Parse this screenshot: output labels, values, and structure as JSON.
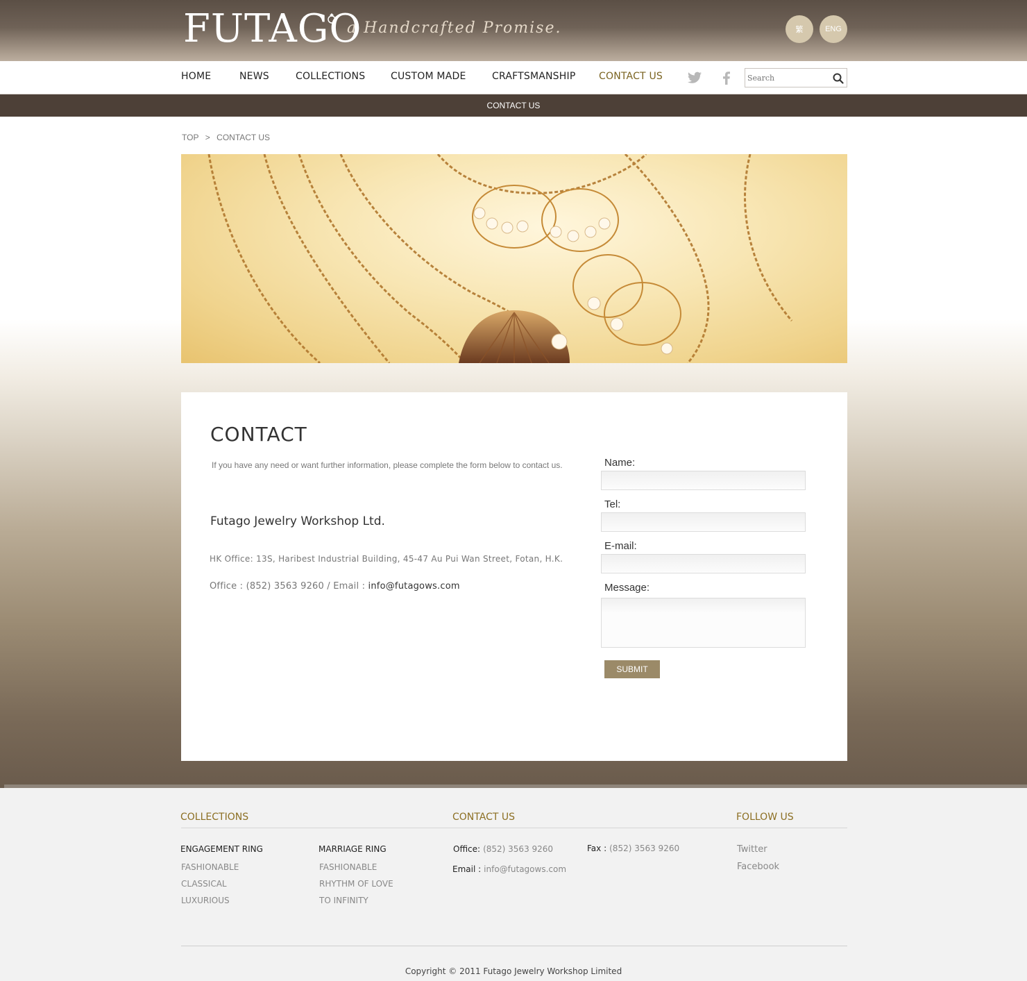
{
  "header": {
    "logo_text": "FUTAGO",
    "tagline": "a Handcrafted Promise.",
    "lang_zh": "繁",
    "lang_en": "ENG"
  },
  "nav": {
    "items": [
      "HOME",
      "NEWS",
      "COLLECTIONS",
      "CUSTOM MADE",
      "CRAFTSMANSHIP",
      "CONTACT US"
    ],
    "active": "CONTACT US",
    "search_placeholder": "Search"
  },
  "subbar": {
    "title": "CONTACT US"
  },
  "breadcrumb": {
    "top": "TOP",
    "sep": ">",
    "current": "CONTACT US"
  },
  "contact": {
    "title": "CONTACT",
    "intro": "If you have any need or want further information, please complete the form below to contact us.",
    "company": "Futago Jewelry Workshop Ltd.",
    "address": "HK Office: 13S, Haribest Industrial Building, 45-47 Au Pui Wan Street, Fotan, H.K.",
    "office_prefix": "Office : (852) 3563 9260 / Email : ",
    "email": "info@futagows.com"
  },
  "form": {
    "name_label": "Name:",
    "tel_label": "Tel:",
    "email_label": "E-mail:",
    "message_label": "Message:",
    "submit_label": "SUBMIT"
  },
  "footer": {
    "collections_heading": "COLLECTIONS",
    "engagement": {
      "heading": "ENGAGEMENT RING",
      "items": [
        "FASHIONABLE",
        "CLASSICAL",
        "LUXURIOUS"
      ]
    },
    "marriage": {
      "heading": "MARRIAGE RING",
      "items": [
        "FASHIONABLE",
        "RHYTHM OF LOVE",
        "TO INFINITY"
      ]
    },
    "contact_heading": "CONTACT US",
    "office_label": "Office:",
    "office_value": "(852) 3563 9260",
    "fax_label": "Fax :",
    "fax_value": "(852) 3563 9260",
    "email_label": "Email :",
    "email_value": "info@futagows.com",
    "follow_heading": "FOLLOW US",
    "follow_items": [
      "Twitter",
      "Facebook"
    ],
    "copyright": "Copyright © 2011 Futago Jewelry Workshop Limited"
  },
  "colors": {
    "header_brown": "#5b4f45",
    "subbar_brown": "#4d4037",
    "accent_gold": "#8c6f23",
    "submit_bg": "#9b8a68",
    "lang_button": "#d5c8ad"
  }
}
